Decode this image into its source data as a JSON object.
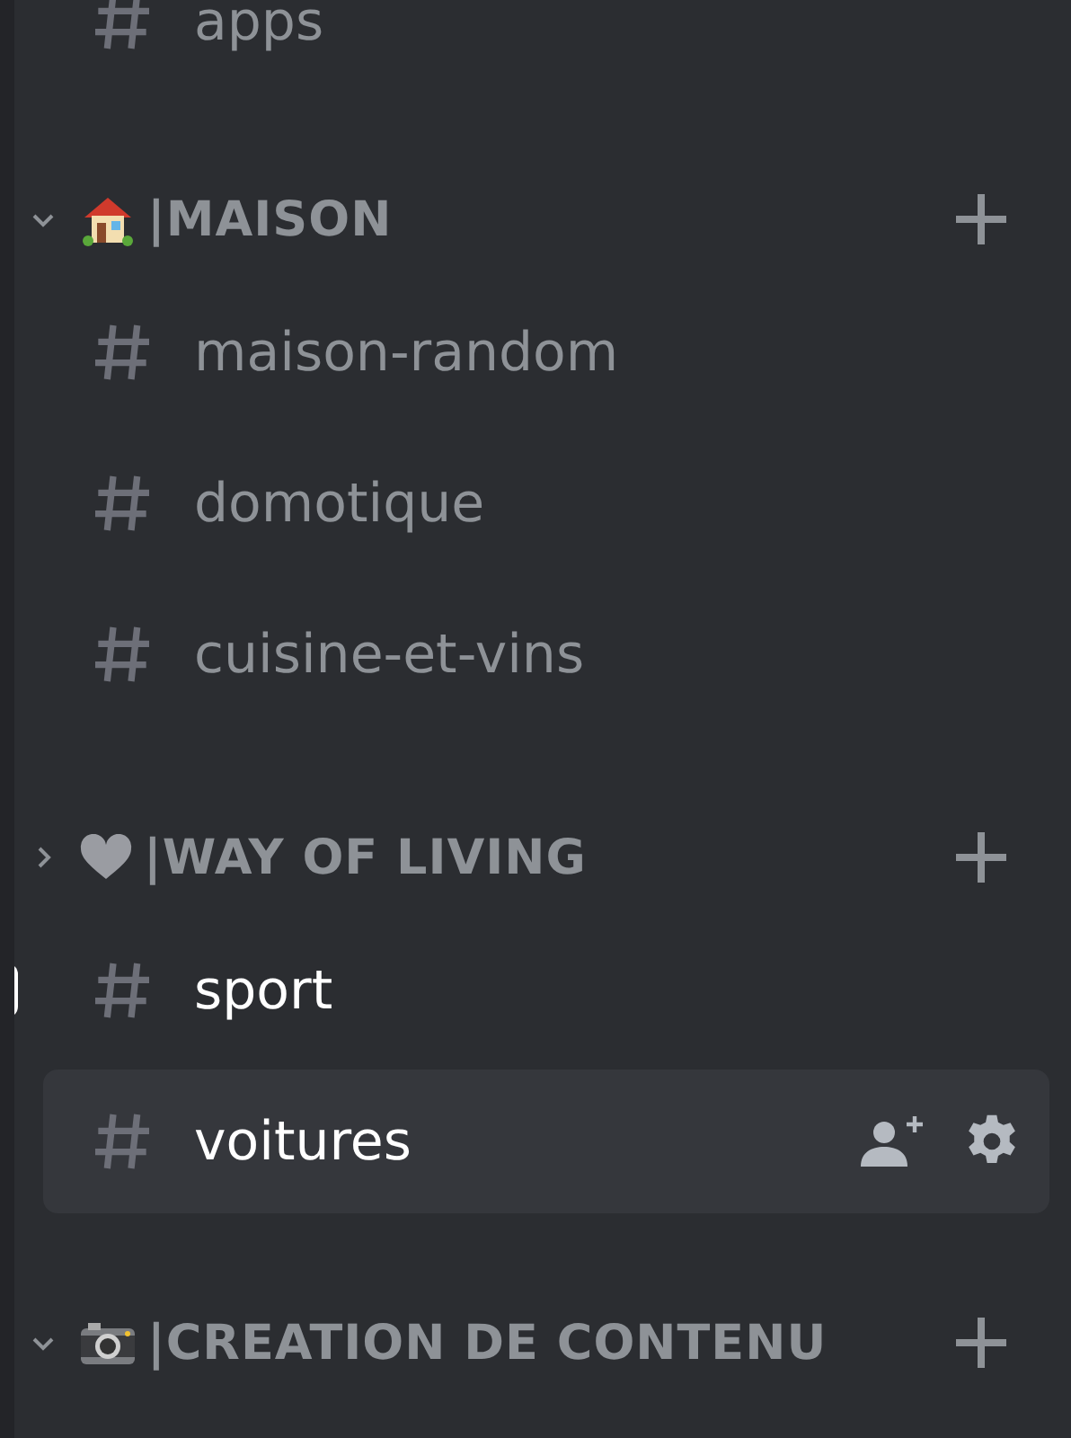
{
  "top_channels": [
    {
      "name": "apps",
      "unread": false,
      "hovered": false
    }
  ],
  "categories": [
    {
      "name": "|MAISON",
      "expanded": true,
      "channels": [
        {
          "name": "maison-random",
          "unread": false,
          "hovered": false
        },
        {
          "name": "domotique",
          "unread": false,
          "hovered": false
        },
        {
          "name": "cuisine-et-vins",
          "unread": false,
          "hovered": false
        }
      ]
    },
    {
      "name": "|WAY OF LIVING",
      "expanded": false,
      "channels": [
        {
          "name": "sport",
          "unread": true,
          "hovered": false
        },
        {
          "name": "voitures",
          "unread": false,
          "hovered": true
        }
      ]
    },
    {
      "name": "|CREATION DE CONTENU",
      "expanded": true
    }
  ]
}
